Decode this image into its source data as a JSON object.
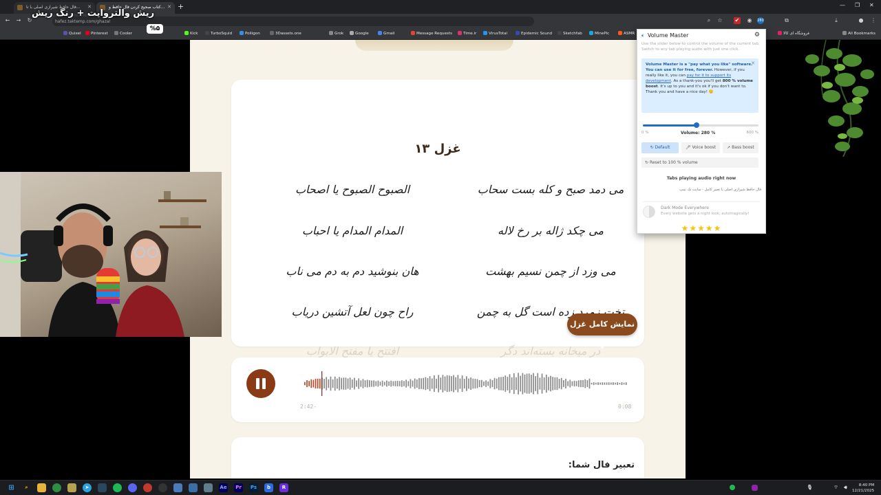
{
  "stream": {
    "title": "ریش والتروایت + رنگ ریش",
    "badge": "%۵"
  },
  "browser": {
    "tabs": [
      {
        "label": "فال حافظ شیرازی اصلی با تا..."
      },
      {
        "label": "کتاب صحیح کردن فال حافظ و..."
      }
    ],
    "url": "hafez.taktemp.com/ghazal",
    "bookmarks": [
      "Quixel",
      "Pinterest",
      "Cooler",
      "Kick",
      "TurboSquid",
      "Poliigon",
      "3Dassets.one",
      "Grok",
      "Google",
      "Gmail",
      "Message Requests",
      "Time.ir",
      "VirusTotal",
      "Epidemic Sound",
      "Sketchfab",
      "MinePic",
      "ASMR",
      "فروشگاه ای کالا",
      "All Bookmarks"
    ],
    "bookmark_colors": [
      "#55a",
      "#e60023",
      "#777",
      "#53fc18",
      "#444",
      "#3a8ee6",
      "#666",
      "#888",
      "#aaa",
      "#4285f4",
      "#ea4335",
      "#e1306c",
      "#2196f3",
      "#3949ab",
      "#444",
      "#1caad9",
      "#ff5722",
      "#e91e63",
      "#888"
    ]
  },
  "page": {
    "ghazal_title": "غزل ۱۳",
    "verses": [
      {
        "right": "می دمد صبح و کله بست سحاب",
        "left": "الصبوح الصبوح یا اصحاب"
      },
      {
        "right": "می چکد ژاله بر رخ لاله",
        "left": "المدام المدام یا احباب"
      },
      {
        "right": "می وزد از چمن نسیم بهشت",
        "left": "هان بنوشید دم به دم می ناب"
      },
      {
        "right": "تخت زمرد زده است گل به چمن",
        "left": "راح چون لعل آتشین دریاب"
      },
      {
        "right": "در میخانه بسته‌اند دگر",
        "left": "افتتح یا مفتح الابواب"
      }
    ],
    "show_full_label": "نمایش کامل غزل ↓",
    "audio": {
      "elapsed": "2:42-",
      "total": "0:08",
      "progress": 0.05
    },
    "interpretation_title": "تعبیر فال شما:"
  },
  "volume_master": {
    "title": "Volume Master",
    "subtitle": "Use the slider below to control the volume of the current tab. Switch to any tab playing audio with just one click.",
    "notice": {
      "bold": "Volume Master is a \"pay what you like\" software. You can use it for free, forever.",
      "text1": " However, if you really like it, you can ",
      "link": "pay for it to support its development",
      "text2": ". As a thank-you you'll get ",
      "bold2": "800 % volume boost",
      "text3": ". It's up to you and it's ok if you don't want to. Thank you and have a nice day! 🙂"
    },
    "slider": {
      "min_label": "0 %",
      "max_label": "600 %",
      "value_label": "Volume: 280 %",
      "value": 280,
      "max": 600
    },
    "modes": [
      "Default",
      "Voice boost",
      "Bass boost"
    ],
    "reset_label": "Reset to 100 % volume",
    "tabs_header": "Tabs playing audio right now",
    "tab_item": "فال حافظ شیرازی اصلی با تعبیر کامل - سایت تک تمپ",
    "dark_mode_title": "Dark Mode Everywhere",
    "dark_mode_sub": "Every website gets a night look, automagically!",
    "stars": "★★★★★",
    "accent": "#1f6fc0"
  },
  "taskbar": {
    "time": "8:40 PM",
    "date": "12/21/2025",
    "apps": [
      "Start",
      "Search",
      "Files",
      "Chrome",
      "Tray",
      "Telegram",
      "Steam",
      "Spotify",
      "Discord",
      "Git",
      "GitHub",
      "Remote",
      "Docs",
      "Notes",
      "Ae",
      "Pr",
      "Ps",
      "b",
      "R"
    ]
  }
}
